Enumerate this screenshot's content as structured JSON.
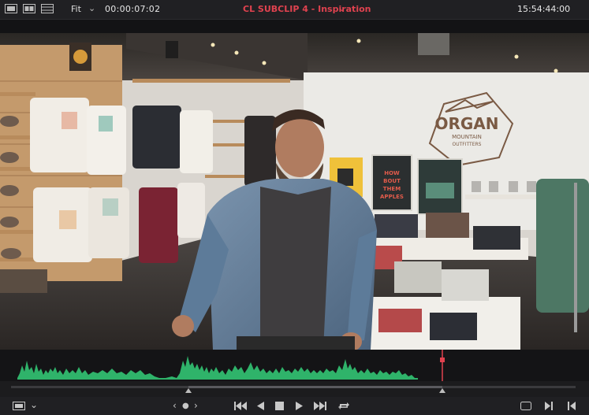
{
  "toolbar": {
    "fit_label": "Fit",
    "timecode": "00:00:07:02",
    "clip_title": "CL SUBCLIP 4 - Inspiration",
    "record_timecode": "15:54:44:00"
  },
  "video": {
    "sign_line1": "ORGAN",
    "sign_line2": "MOUNTAIN",
    "sign_line3": "OUTFITTERS",
    "poster1_line1": "HOW",
    "poster1_line2": "BOUT",
    "poster1_line3": "THEM",
    "poster1_line4": "APPLES"
  },
  "colors": {
    "title_red": "#e0424f",
    "waveform_green": "#2fb36a",
    "playhead_red": "#e0424f"
  }
}
